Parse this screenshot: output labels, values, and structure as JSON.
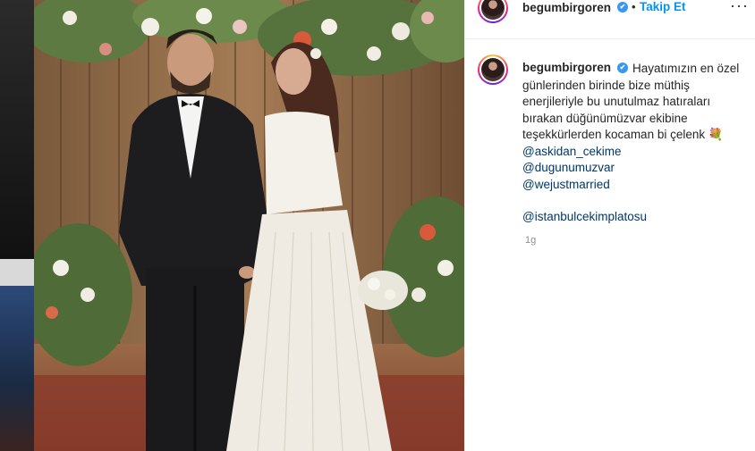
{
  "post": {
    "username": "begumbirgoren",
    "verified_mark": "✔",
    "separator": "•",
    "follow_label": "Takip Et",
    "more_label": "···"
  },
  "caption": {
    "username": "begumbirgoren",
    "text": "Hayatımızın en özel günlerinden birinde bize müthiş enerjileriyle bu unutulmaz hatıraları bırakan düğünümüzvar ekibine teşekkürlerden kocaman bi çelenk 💐",
    "mentions": [
      "@askidan_cekime",
      "@dugunumuzvar",
      "@wejustmarried"
    ],
    "hashtag_mention": "@istanbulcekimplatosu",
    "time": "1g"
  },
  "icons": {
    "verified": "verified-badge-icon",
    "more": "more-options-icon"
  },
  "colors": {
    "link": "#0095f6",
    "mention": "#00376b",
    "verified": "#3897f0",
    "muted": "#8e8e8e"
  }
}
